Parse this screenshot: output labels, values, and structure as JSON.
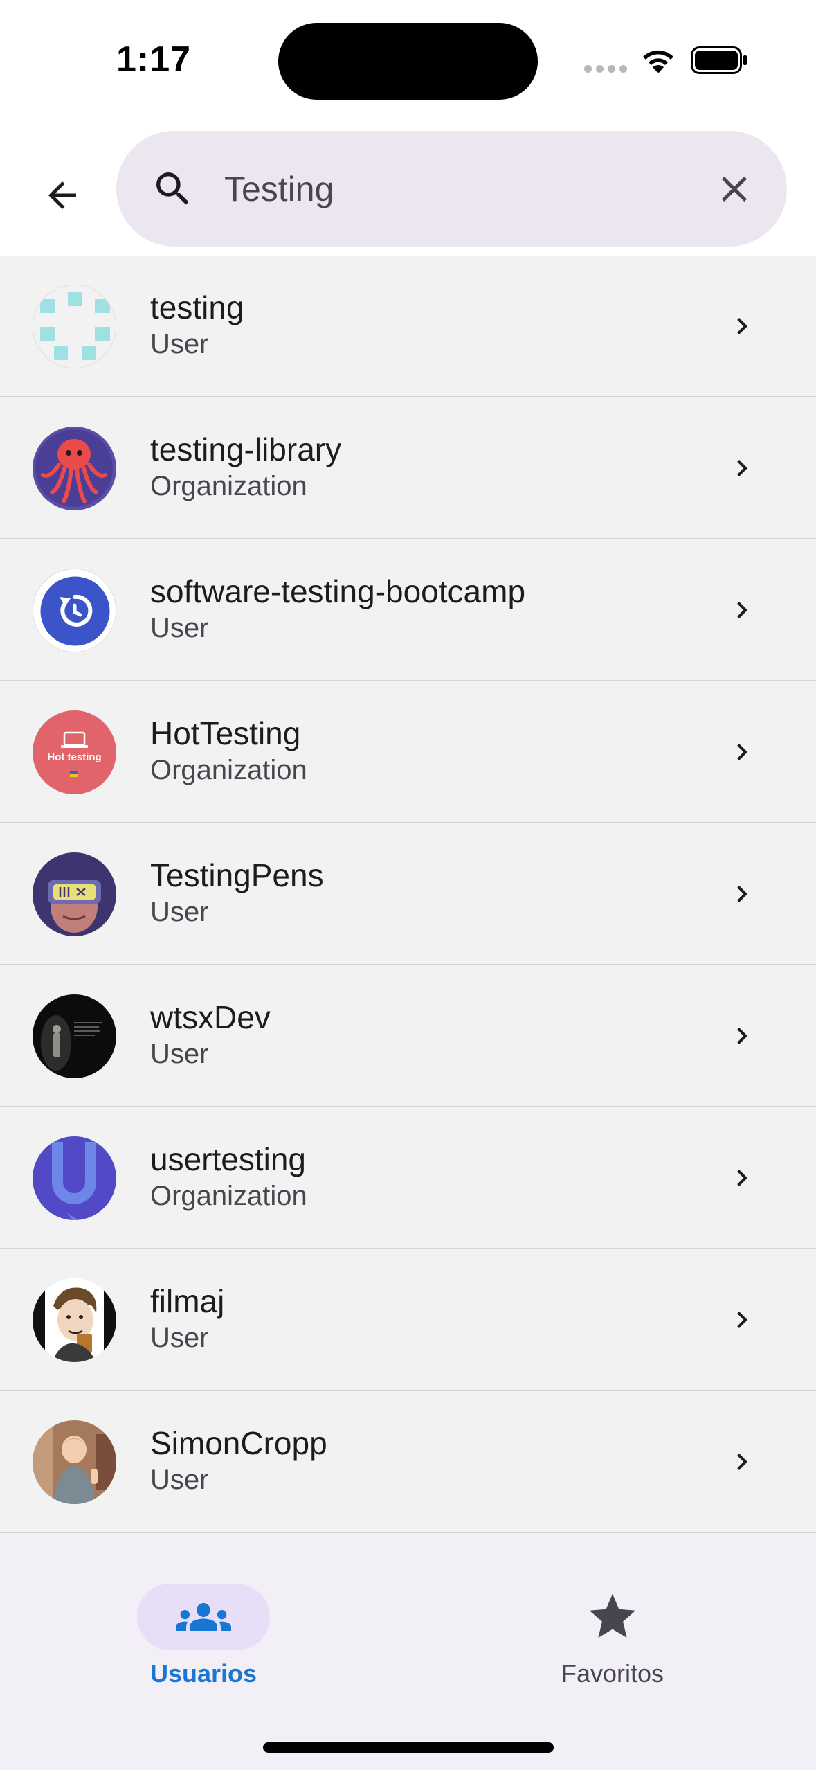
{
  "status_bar": {
    "time": "1:17"
  },
  "search": {
    "value": "Testing"
  },
  "results": [
    {
      "name": "testing",
      "type": "User",
      "avatar": "identicon-avatar"
    },
    {
      "name": "testing-library",
      "type": "Organization",
      "avatar": "octopus-avatar"
    },
    {
      "name": "software-testing-bootcamp",
      "type": "User",
      "avatar": "refresh-logo-avatar"
    },
    {
      "name": "HotTesting",
      "type": "Organization",
      "avatar": "hot-testing-logo-avatar",
      "avatar_text": "Hot testing"
    },
    {
      "name": "TestingPens",
      "type": "User",
      "avatar": "vr-face-avatar"
    },
    {
      "name": "wtsxDev",
      "type": "User",
      "avatar": "dark-photo-avatar"
    },
    {
      "name": "usertesting",
      "type": "Organization",
      "avatar": "u-logo-avatar"
    },
    {
      "name": "filmaj",
      "type": "User",
      "avatar": "cartoon-portrait-avatar"
    },
    {
      "name": "SimonCropp",
      "type": "User",
      "avatar": "child-photo-avatar"
    }
  ],
  "bottom_nav": {
    "users_label": "Usuarios",
    "favorites_label": "Favoritos"
  },
  "colors": {
    "search_bg": "#ece6f0",
    "list_bg": "#f2f2f2",
    "nav_bg": "#f3eff7",
    "active_pill": "#e8def8",
    "active_accent": "#1976d2"
  }
}
